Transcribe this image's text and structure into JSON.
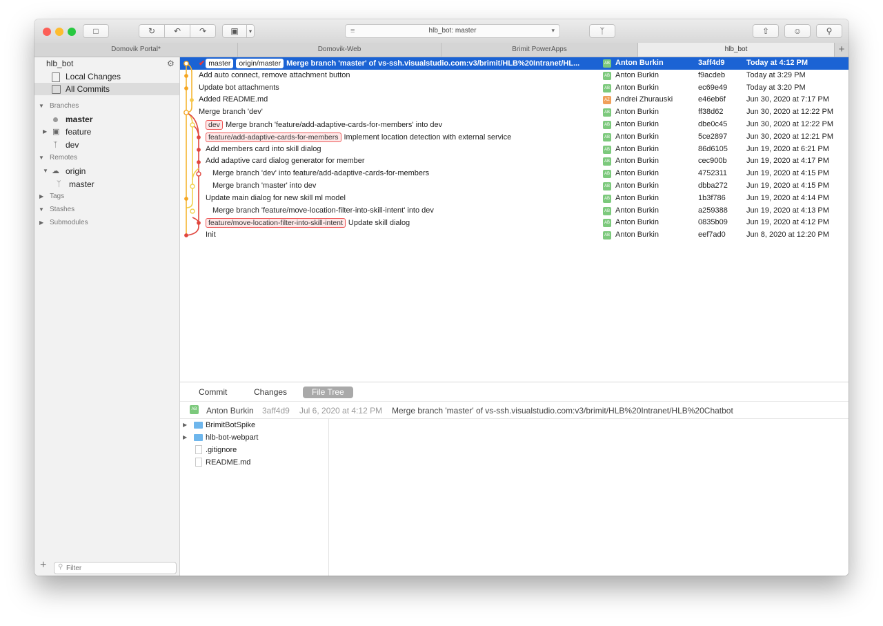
{
  "window": {
    "title": "hlb_bot: master"
  },
  "tabs": [
    {
      "label": "Domovik Portal*"
    },
    {
      "label": "Domovik-Web"
    },
    {
      "label": "Brimit PowerApps"
    },
    {
      "label": "hlb_bot"
    }
  ],
  "sidebar": {
    "repo_name": "hlb_bot",
    "local_changes": "Local Changes",
    "all_commits": "All Commits",
    "branches_header": "Branches",
    "branches": [
      "master",
      "feature",
      "dev"
    ],
    "remotes_header": "Remotes",
    "remote_name": "origin",
    "remote_branch": "master",
    "tags_header": "Tags",
    "stashes_header": "Stashes",
    "submodules_header": "Submodules",
    "filter_placeholder": "Filter"
  },
  "commits": [
    {
      "tags": [
        "master",
        "origin/master"
      ],
      "message": "Merge branch 'master' of vs-ssh.visualstudio.com:v3/brimit/HLB%20Intranet/HL...",
      "initials": "AB",
      "author": "Anton Burkin",
      "sha": "3aff4d9",
      "date": "Today at 4:12 PM"
    },
    {
      "tags": [],
      "message": "Add auto connect, remove attachment button",
      "initials": "AB",
      "author": "Anton Burkin",
      "sha": "f9acdeb",
      "date": "Today at 3:29 PM"
    },
    {
      "tags": [],
      "message": "Update bot attachments",
      "initials": "AB",
      "author": "Anton Burkin",
      "sha": "ec69e49",
      "date": "Today at 3:20 PM"
    },
    {
      "tags": [],
      "message": "Added README.md",
      "initials": "AZ",
      "author": "Andrei Zhurauski",
      "sha": "e46eb6f",
      "date": "Jun 30, 2020 at 7:17 PM"
    },
    {
      "tags": [],
      "message": "Merge branch 'dev'",
      "initials": "AB",
      "author": "Anton Burkin",
      "sha": "ff38d62",
      "date": "Jun 30, 2020 at 12:22 PM"
    },
    {
      "tags": [
        "dev"
      ],
      "message": "Merge branch 'feature/add-adaptive-cards-for-members' into dev",
      "initials": "AB",
      "author": "Anton Burkin",
      "sha": "dbe0c45",
      "date": "Jun 30, 2020 at 12:22 PM"
    },
    {
      "tags": [
        "feature/add-adaptive-cards-for-members"
      ],
      "message": "Implement location detection with external service",
      "initials": "AB",
      "author": "Anton Burkin",
      "sha": "5ce2897",
      "date": "Jun 30, 2020 at 12:21 PM"
    },
    {
      "tags": [],
      "message": "Add members card into skill dialog",
      "initials": "AB",
      "author": "Anton Burkin",
      "sha": "86d6105",
      "date": "Jun 19, 2020 at 6:21 PM"
    },
    {
      "tags": [],
      "message": "Add adaptive card dialog generator for member",
      "initials": "AB",
      "author": "Anton Burkin",
      "sha": "cec900b",
      "date": "Jun 19, 2020 at 4:17 PM"
    },
    {
      "tags": [],
      "message": "Merge branch 'dev' into feature/add-adaptive-cards-for-members",
      "initials": "AB",
      "author": "Anton Burkin",
      "sha": "4752311",
      "date": "Jun 19, 2020 at 4:15 PM"
    },
    {
      "tags": [],
      "message": "Merge branch 'master' into dev",
      "initials": "AB",
      "author": "Anton Burkin",
      "sha": "dbba272",
      "date": "Jun 19, 2020 at 4:15 PM"
    },
    {
      "tags": [],
      "message": "Update main dialog for new skill ml model",
      "initials": "AB",
      "author": "Anton Burkin",
      "sha": "1b3f786",
      "date": "Jun 19, 2020 at 4:14 PM"
    },
    {
      "tags": [],
      "message": "Merge branch 'feature/move-location-filter-into-skill-intent' into dev",
      "initials": "AB",
      "author": "Anton Burkin",
      "sha": "a259388",
      "date": "Jun 19, 2020 at 4:13 PM"
    },
    {
      "tags": [
        "feature/move-location-filter-into-skill-intent"
      ],
      "message": "Update skill dialog",
      "initials": "AB",
      "author": "Anton Burkin",
      "sha": "0835b09",
      "date": "Jun 19, 2020 at 4:12 PM"
    },
    {
      "tags": [],
      "message": "Init",
      "initials": "AB",
      "author": "Anton Burkin",
      "sha": "eef7ad0",
      "date": "Jun 8, 2020 at 12:20 PM"
    }
  ],
  "lower": {
    "tabs": [
      "Commit",
      "Changes",
      "File Tree"
    ],
    "active_tab": "File Tree",
    "commit_info": {
      "initials": "AB",
      "author": "Anton Burkin",
      "sha": "3aff4d9",
      "date": "Jul 6, 2020 at 4:12 PM",
      "message": "Merge branch 'master' of vs-ssh.visualstudio.com:v3/brimit/HLB%20Intranet/HLB%20Chatbot"
    },
    "files": [
      {
        "name": "BrimitBotSpike",
        "type": "folder"
      },
      {
        "name": "hlb-bot-webpart",
        "type": "folder"
      },
      {
        "name": ".gitignore",
        "type": "file"
      },
      {
        "name": "README.md",
        "type": "file"
      }
    ]
  },
  "colors": {
    "selection": "#1b63d4",
    "graph_orange": "#f5a623",
    "graph_red": "#e0463e",
    "tag_border": "#e55555"
  },
  "icons": [
    "folder-icon",
    "undo-icon",
    "pull-icon",
    "push-icon",
    "archive-icon",
    "merge-icon",
    "share-icon",
    "smiley-icon",
    "search-icon",
    "gear-icon",
    "plus-icon"
  ]
}
